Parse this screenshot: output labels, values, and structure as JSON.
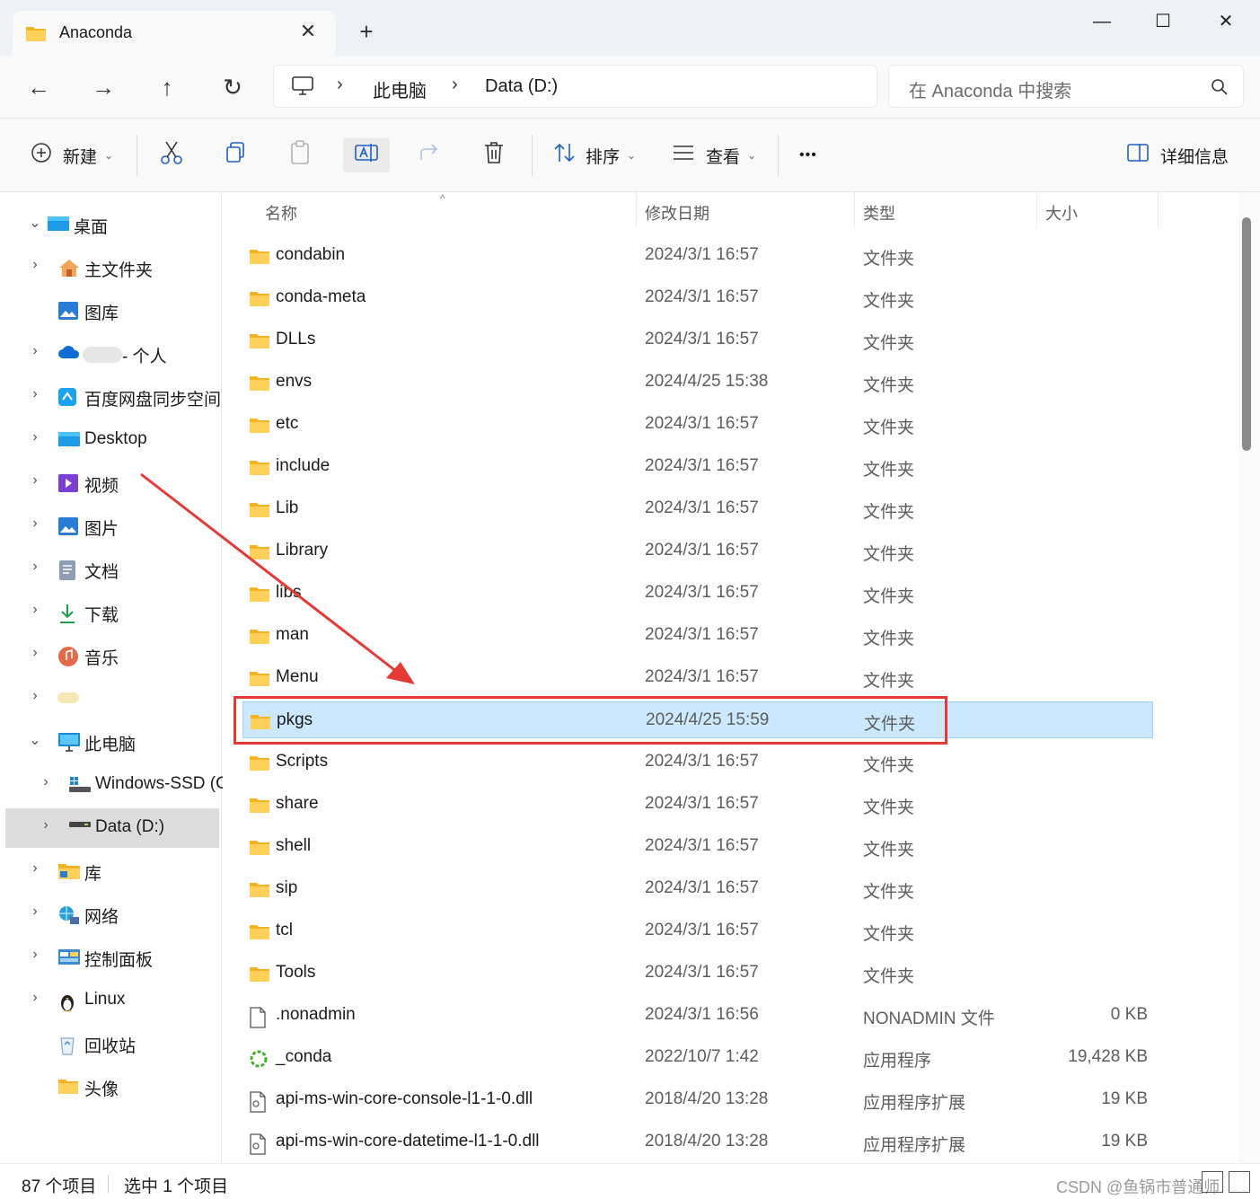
{
  "window": {
    "tab_title": "Anaconda",
    "tab_close": "✕",
    "new_tab": "+",
    "minimize": "—",
    "maximize": "☐",
    "close": "✕"
  },
  "nav": {
    "back": "←",
    "forward": "→",
    "up": "↑",
    "refresh": "↻",
    "breadcrumb": [
      "此电脑",
      "Data (D:)"
    ],
    "breadcrumb_sep": "›",
    "search_placeholder": "在 Anaconda 中搜索"
  },
  "toolbar": {
    "new_label": "新建",
    "sort_label": "排序",
    "view_label": "查看",
    "more_label": "•••",
    "details_label": "详细信息"
  },
  "sidebar": {
    "items": [
      {
        "label": "桌面",
        "chevron": "⌄",
        "icon": "desktop-folder-icon"
      },
      {
        "label": "主文件夹",
        "chevron": "›",
        "icon": "home-icon"
      },
      {
        "label": "图库",
        "chevron": "",
        "icon": "gallery-icon"
      },
      {
        "label": "- 个人",
        "chevron": "›",
        "icon": "onedrive-cloud-icon"
      },
      {
        "label": "百度网盘同步空间",
        "chevron": "›",
        "icon": "baidu-netdisk-icon"
      },
      {
        "label": "Desktop",
        "chevron": "›",
        "icon": "desktop-folder-icon"
      },
      {
        "label": "视频",
        "chevron": "›",
        "icon": "video-icon"
      },
      {
        "label": "图片",
        "chevron": "›",
        "icon": "pictures-icon"
      },
      {
        "label": "文档",
        "chevron": "›",
        "icon": "documents-icon"
      },
      {
        "label": "下载",
        "chevron": "›",
        "icon": "download-icon"
      },
      {
        "label": "音乐",
        "chevron": "›",
        "icon": "music-icon"
      },
      {
        "label": "",
        "chevron": "›",
        "icon": "blurred-icon"
      },
      {
        "label": "此电脑",
        "chevron": "⌄",
        "icon": "this-pc-icon"
      },
      {
        "label": "Windows-SSD (C",
        "chevron": "›",
        "icon": "windows-drive-icon"
      },
      {
        "label": "Data (D:)",
        "chevron": "›",
        "icon": "drive-icon"
      },
      {
        "label": "库",
        "chevron": "›",
        "icon": "library-icon"
      },
      {
        "label": "网络",
        "chevron": "›",
        "icon": "network-icon"
      },
      {
        "label": "控制面板",
        "chevron": "›",
        "icon": "control-panel-icon"
      },
      {
        "label": "Linux",
        "chevron": "›",
        "icon": "linux-penguin-icon"
      },
      {
        "label": "回收站",
        "chevron": "",
        "icon": "recycle-bin-icon"
      },
      {
        "label": "头像",
        "chevron": "",
        "icon": "folder-icon"
      }
    ]
  },
  "columns": {
    "name": "名称",
    "modified": "修改日期",
    "type": "类型",
    "size": "大小",
    "sort_indicator": "^"
  },
  "files": [
    {
      "name": "condabin",
      "date": "2024/3/1 16:57",
      "type": "文件夹",
      "size": "",
      "icon": "folder-icon"
    },
    {
      "name": "conda-meta",
      "date": "2024/3/1 16:57",
      "type": "文件夹",
      "size": "",
      "icon": "folder-icon"
    },
    {
      "name": "DLLs",
      "date": "2024/3/1 16:57",
      "type": "文件夹",
      "size": "",
      "icon": "folder-icon"
    },
    {
      "name": "envs",
      "date": "2024/4/25 15:38",
      "type": "文件夹",
      "size": "",
      "icon": "folder-icon"
    },
    {
      "name": "etc",
      "date": "2024/3/1 16:57",
      "type": "文件夹",
      "size": "",
      "icon": "folder-icon"
    },
    {
      "name": "include",
      "date": "2024/3/1 16:57",
      "type": "文件夹",
      "size": "",
      "icon": "folder-icon"
    },
    {
      "name": "Lib",
      "date": "2024/3/1 16:57",
      "type": "文件夹",
      "size": "",
      "icon": "folder-icon"
    },
    {
      "name": "Library",
      "date": "2024/3/1 16:57",
      "type": "文件夹",
      "size": "",
      "icon": "folder-icon"
    },
    {
      "name": "libs",
      "date": "2024/3/1 16:57",
      "type": "文件夹",
      "size": "",
      "icon": "folder-icon"
    },
    {
      "name": "man",
      "date": "2024/3/1 16:57",
      "type": "文件夹",
      "size": "",
      "icon": "folder-icon"
    },
    {
      "name": "Menu",
      "date": "2024/3/1 16:57",
      "type": "文件夹",
      "size": "",
      "icon": "folder-icon"
    },
    {
      "name": "pkgs",
      "date": "2024/4/25 15:59",
      "type": "文件夹",
      "size": "",
      "icon": "folder-icon",
      "selected": true
    },
    {
      "name": "Scripts",
      "date": "2024/3/1 16:57",
      "type": "文件夹",
      "size": "",
      "icon": "folder-icon"
    },
    {
      "name": "share",
      "date": "2024/3/1 16:57",
      "type": "文件夹",
      "size": "",
      "icon": "folder-icon"
    },
    {
      "name": "shell",
      "date": "2024/3/1 16:57",
      "type": "文件夹",
      "size": "",
      "icon": "folder-icon"
    },
    {
      "name": "sip",
      "date": "2024/3/1 16:57",
      "type": "文件夹",
      "size": "",
      "icon": "folder-icon"
    },
    {
      "name": "tcl",
      "date": "2024/3/1 16:57",
      "type": "文件夹",
      "size": "",
      "icon": "folder-icon"
    },
    {
      "name": "Tools",
      "date": "2024/3/1 16:57",
      "type": "文件夹",
      "size": "",
      "icon": "folder-icon"
    },
    {
      "name": ".nonadmin",
      "date": "2024/3/1 16:56",
      "type": "NONADMIN 文件",
      "size": "0 KB",
      "icon": "file-icon"
    },
    {
      "name": "_conda",
      "date": "2022/10/7 1:42",
      "type": "应用程序",
      "size": "19,428 KB",
      "icon": "conda-app-icon"
    },
    {
      "name": "api-ms-win-core-console-l1-1-0.dll",
      "date": "2018/4/20 13:28",
      "type": "应用程序扩展",
      "size": "19 KB",
      "icon": "dll-file-icon"
    },
    {
      "name": "api-ms-win-core-datetime-l1-1-0.dll",
      "date": "2018/4/20 13:28",
      "type": "应用程序扩展",
      "size": "19 KB",
      "icon": "dll-file-icon"
    }
  ],
  "status": {
    "item_count": "87 个项目",
    "selected_count": "选中 1 个项目",
    "watermark": "CSDN @鱼锅市普通师"
  },
  "colors": {
    "selection": "#cce8ff",
    "annotation": "#e53935",
    "folder": "#f8c843"
  }
}
